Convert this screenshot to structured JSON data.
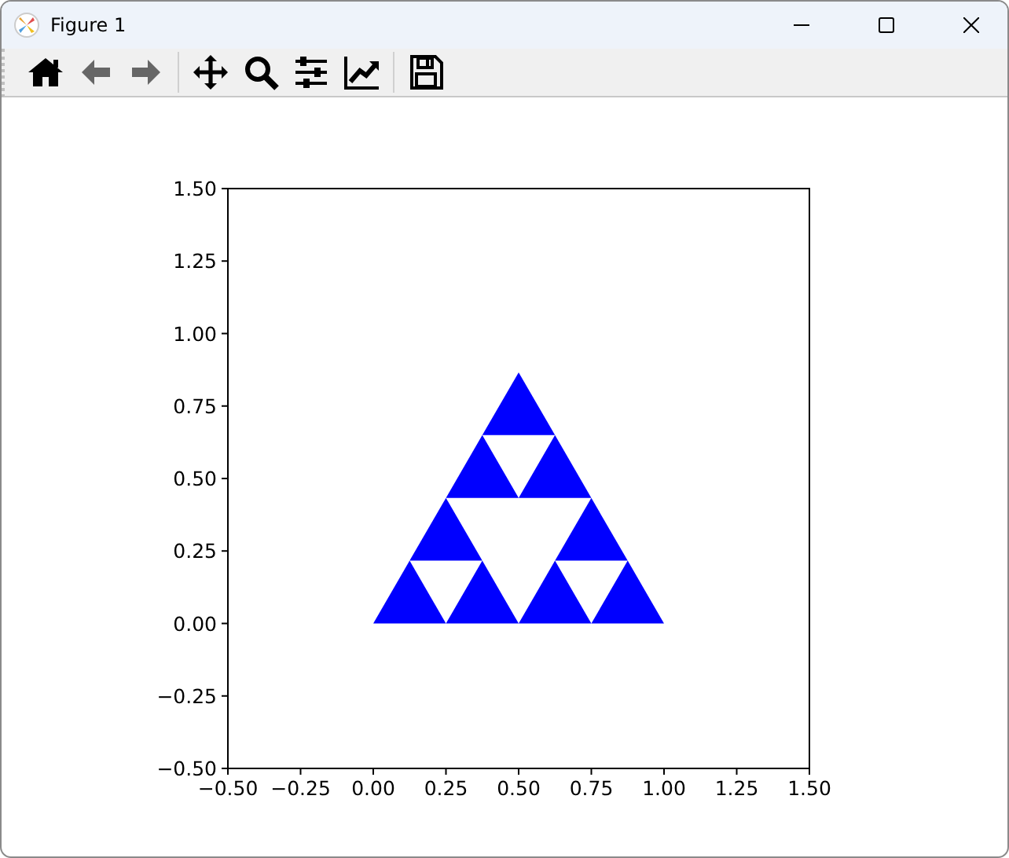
{
  "window": {
    "title": "Figure 1"
  },
  "toolbar": [
    {
      "kind": "home",
      "disabled": false
    },
    {
      "kind": "back",
      "disabled": true
    },
    {
      "kind": "forward",
      "disabled": true
    },
    {
      "kind": "separator"
    },
    {
      "kind": "pan",
      "disabled": false
    },
    {
      "kind": "zoom",
      "disabled": false
    },
    {
      "kind": "subplots",
      "disabled": false
    },
    {
      "kind": "axes",
      "disabled": false
    },
    {
      "kind": "separator"
    },
    {
      "kind": "save",
      "disabled": false
    }
  ],
  "figure": {
    "chart_data": {
      "type": "area",
      "xlim": [
        -0.5,
        1.5
      ],
      "ylim": [
        -0.5,
        1.5
      ],
      "xticks": [
        {
          "value": -0.5,
          "label": "−0.50"
        },
        {
          "value": -0.25,
          "label": "−0.25"
        },
        {
          "value": 0,
          "label": "0.00"
        },
        {
          "value": 0.25,
          "label": "0.25"
        },
        {
          "value": 0.5,
          "label": "0.50"
        },
        {
          "value": 0.75,
          "label": "0.75"
        },
        {
          "value": 1,
          "label": "1.00"
        },
        {
          "value": 1.25,
          "label": "1.25"
        },
        {
          "value": 1.5,
          "label": "1.50"
        }
      ],
      "yticks": [
        {
          "value": -0.5,
          "label": "−0.50"
        },
        {
          "value": -0.25,
          "label": "−0.25"
        },
        {
          "value": 0,
          "label": "0.00"
        },
        {
          "value": 0.25,
          "label": "0.25"
        },
        {
          "value": 0.5,
          "label": "0.50"
        },
        {
          "value": 0.75,
          "label": "0.75"
        },
        {
          "value": 1,
          "label": "1.00"
        },
        {
          "value": 1.25,
          "label": "1.25"
        },
        {
          "value": 1.5,
          "label": "1.50"
        }
      ],
      "series": [
        {
          "color": "#0000ff",
          "x": [
            0,
            0.25,
            0.125
          ],
          "values": [
            0,
            0,
            0.2165
          ]
        },
        {
          "color": "#0000ff",
          "x": [
            0.25,
            0.5,
            0.375
          ],
          "values": [
            0,
            0,
            0.2165
          ]
        },
        {
          "color": "#0000ff",
          "x": [
            0.125,
            0.375,
            0.25
          ],
          "values": [
            0.2165,
            0.2165,
            0.433
          ]
        },
        {
          "color": "#0000ff",
          "x": [
            0.5,
            0.75,
            0.625
          ],
          "values": [
            0,
            0,
            0.2165
          ]
        },
        {
          "color": "#0000ff",
          "x": [
            0.75,
            1,
            0.875
          ],
          "values": [
            0,
            0,
            0.2165
          ]
        },
        {
          "color": "#0000ff",
          "x": [
            0.625,
            0.875,
            0.75
          ],
          "values": [
            0.2165,
            0.2165,
            0.433
          ]
        },
        {
          "color": "#0000ff",
          "x": [
            0.25,
            0.5,
            0.375
          ],
          "values": [
            0.433,
            0.433,
            0.6495
          ]
        },
        {
          "color": "#0000ff",
          "x": [
            0.5,
            0.75,
            0.625
          ],
          "values": [
            0.433,
            0.433,
            0.6495
          ]
        },
        {
          "color": "#0000ff",
          "x": [
            0.375,
            0.625,
            0.5
          ],
          "values": [
            0.6495,
            0.6495,
            0.866
          ]
        }
      ]
    }
  }
}
